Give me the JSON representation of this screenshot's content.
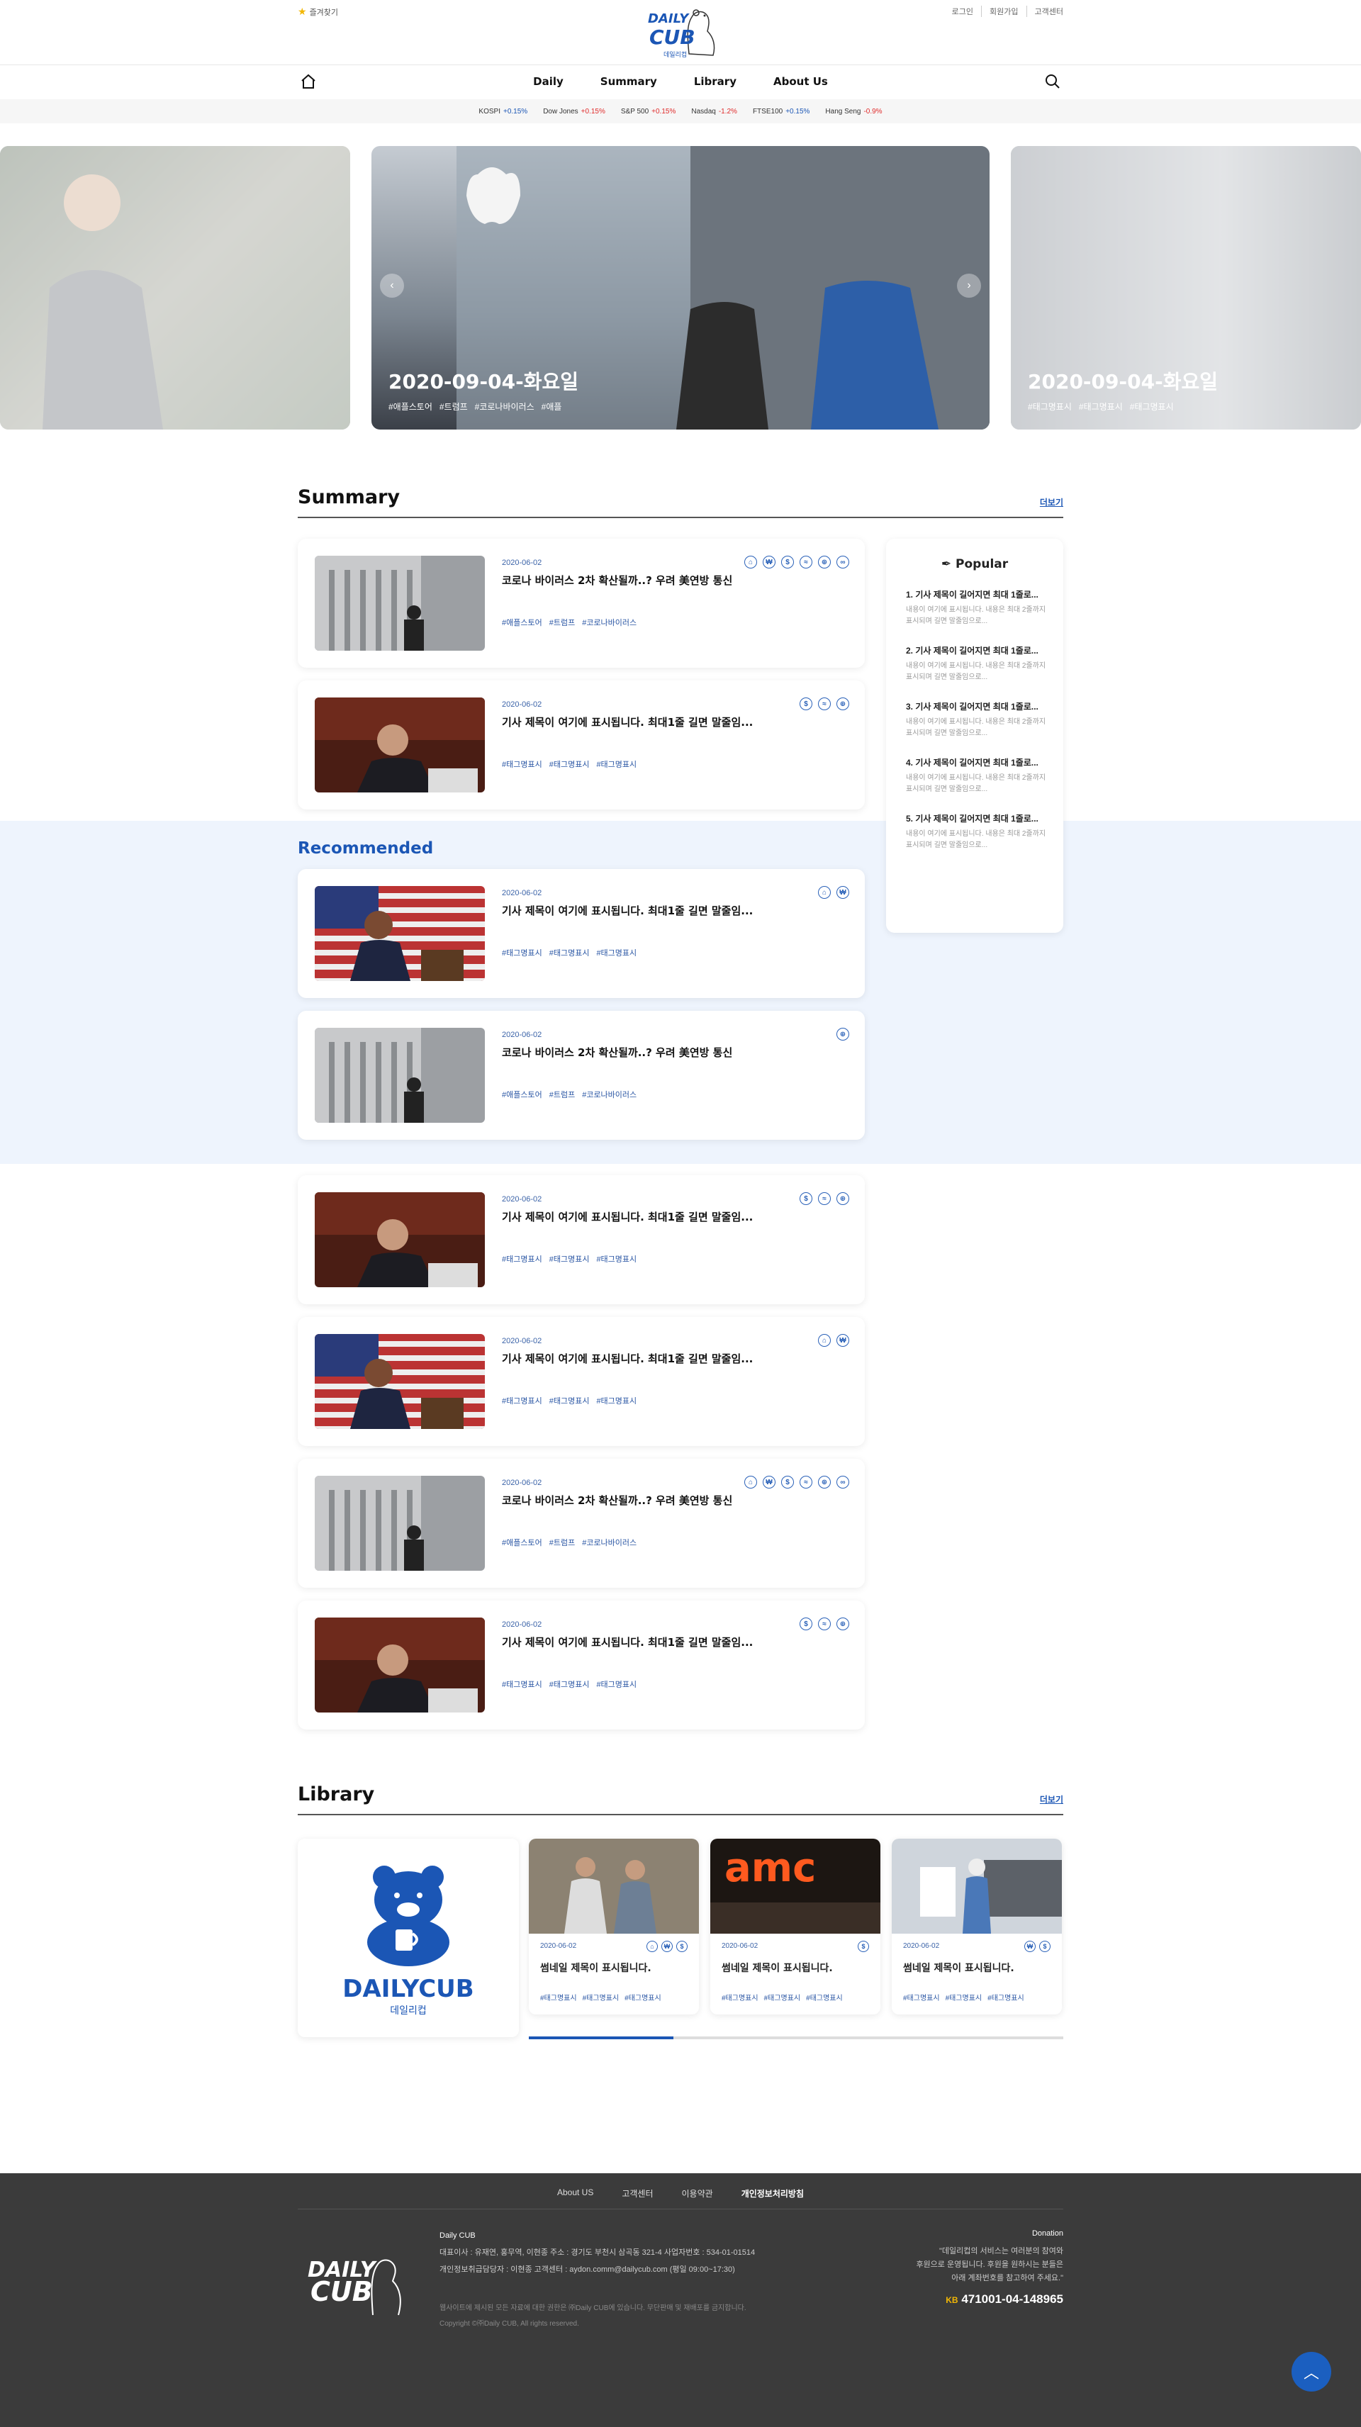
{
  "header": {
    "favorite": "즐겨찾기",
    "links": [
      "로그인",
      "회원가입",
      "고객센터"
    ],
    "logo_text_1": "DAILY",
    "logo_text_2": "CUB",
    "logo_sub": "데일리컵"
  },
  "nav": {
    "items": [
      "Daily",
      "Summary",
      "Library",
      "About Us"
    ]
  },
  "ticker": [
    {
      "name": "KOSPI",
      "change": "+0.15%",
      "dir": "up"
    },
    {
      "name": "Dow Jones",
      "change": "+0.15%",
      "dir": "down"
    },
    {
      "name": "S&P 500",
      "change": "+0.15%",
      "dir": "down"
    },
    {
      "name": "Nasdaq",
      "change": "-1.2%",
      "dir": "down"
    },
    {
      "name": "FTSE100",
      "change": "+0.15%",
      "dir": "up"
    },
    {
      "name": "Hang Seng",
      "change": "-0.9%",
      "dir": "down"
    }
  ],
  "carousel": {
    "main": {
      "date": "2020-09-04-화요일",
      "tags": [
        "#애플스토어",
        "#트럼프",
        "#코로나바이러스",
        "#애플"
      ]
    },
    "right": {
      "date": "2020-09-04-화요일",
      "tags": [
        "#태그명표시",
        "#태그명표시",
        "#태그명표시"
      ]
    }
  },
  "summary": {
    "heading": "Summary",
    "more": "더보기",
    "cards": [
      {
        "date": "2020-06-02",
        "title": "코로나 바이러스 2차 확산될까..? 우려 美연방 통신",
        "tags": [
          "#애플스토어",
          "#트럼프",
          "#코로나바이러스"
        ],
        "icons": [
          "bank",
          "won",
          "dollar",
          "wave",
          "globe",
          "people"
        ]
      },
      {
        "date": "2020-06-02",
        "title": "기사 제목이 여기에 표시됩니다. 최대1줄 길면 말줄임...",
        "tags": [
          "#태그명표시",
          "#태그명표시",
          "#태그명표시"
        ],
        "icons": [
          "dollar",
          "wave",
          "globe"
        ]
      }
    ]
  },
  "recommended": {
    "heading": "Recommended",
    "cards": [
      {
        "date": "2020-06-02",
        "title": "기사 제목이 여기에 표시됩니다. 최대1줄 길면 말줄임...",
        "tags": [
          "#태그명표시",
          "#태그명표시",
          "#태그명표시"
        ],
        "icons": [
          "bank",
          "won"
        ]
      },
      {
        "date": "2020-06-02",
        "title": "코로나 바이러스 2차 확산될까..? 우려 美연방 통신",
        "tags": [
          "#애플스토어",
          "#트럼프",
          "#코로나바이러스"
        ],
        "icons": [
          "globe"
        ]
      }
    ]
  },
  "more_cards": [
    {
      "date": "2020-06-02",
      "title": "기사 제목이 여기에 표시됩니다. 최대1줄 길면 말줄임...",
      "tags": [
        "#태그명표시",
        "#태그명표시",
        "#태그명표시"
      ],
      "icons": [
        "dollar",
        "wave",
        "globe"
      ]
    },
    {
      "date": "2020-06-02",
      "title": "기사 제목이 여기에 표시됩니다. 최대1줄 길면 말줄임...",
      "tags": [
        "#태그명표시",
        "#태그명표시",
        "#태그명표시"
      ],
      "icons": [
        "bank",
        "won"
      ]
    },
    {
      "date": "2020-06-02",
      "title": "코로나 바이러스 2차 확산될까..? 우려 美연방 통신",
      "tags": [
        "#애플스토어",
        "#트럼프",
        "#코로나바이러스"
      ],
      "icons": [
        "bank",
        "won",
        "dollar",
        "wave",
        "globe",
        "people"
      ]
    },
    {
      "date": "2020-06-02",
      "title": "기사 제목이 여기에 표시됩니다. 최대1줄 길면 말줄임...",
      "tags": [
        "#태그명표시",
        "#태그명표시",
        "#태그명표시"
      ],
      "icons": [
        "dollar",
        "wave",
        "globe"
      ]
    }
  ],
  "popular": {
    "heading": "Popular",
    "items": [
      {
        "title": "1. 기사 제목이 길어지면 최대 1줄로...",
        "desc": "내용이 여기에 표시됩니다. 내용은 최대 2줄까지 표시되며 길면 말줄임으로..."
      },
      {
        "title": "2. 기사 제목이 길어지면 최대 1줄로...",
        "desc": "내용이 여기에 표시됩니다. 내용은 최대 2줄까지 표시되며 길면 말줄임으로..."
      },
      {
        "title": "3. 기사 제목이 길어지면 최대 1줄로...",
        "desc": "내용이 여기에 표시됩니다. 내용은 최대 2줄까지 표시되며 길면 말줄임으로..."
      },
      {
        "title": "4. 기사 제목이 길어지면 최대 1줄로...",
        "desc": "내용이 여기에 표시됩니다. 내용은 최대 2줄까지 표시되며 길면 말줄임으로..."
      },
      {
        "title": "5. 기사 제목이 길어지면 최대 1줄로...",
        "desc": "내용이 여기에 표시됩니다. 내용은 최대 2줄까지 표시되며 길면 말줄임으로..."
      }
    ]
  },
  "library": {
    "heading": "Library",
    "more": "더보기",
    "brand": "DAILYCUB",
    "brand_sub": "데일리컵",
    "cards": [
      {
        "date": "2020-06-02",
        "title": "썸네일 제목이 표시됩니다.",
        "tags": [
          "#태그명표시",
          "#태그명표시",
          "#태그명표시"
        ],
        "icons": [
          "bank",
          "won",
          "dollar"
        ]
      },
      {
        "date": "2020-06-02",
        "title": "썸네일 제목이 표시됩니다.",
        "tags": [
          "#태그명표시",
          "#태그명표시",
          "#태그명표시"
        ],
        "icons": [
          "dollar"
        ]
      },
      {
        "date": "2020-06-02",
        "title": "썸네일 제목이 표시됩니다.",
        "tags": [
          "#태그명표시",
          "#태그명표시",
          "#태그명표시"
        ],
        "icons": [
          "won",
          "dollar"
        ]
      }
    ],
    "scroll_progress": 0.27
  },
  "footer": {
    "links": [
      "About US",
      "고객센터",
      "이용약관",
      "개인정보처리방침"
    ],
    "company": "Daily CUB",
    "line1": "대표이사 : 유재연, 홍무역, 이현종     주소 : 경기도 부천시 삼곡동 321-4     사업자번호 : 534-01-01514",
    "line2": "개인정보취급담당자 : 이현종     고객센터 : aydon.comm@dailycub.com (평일 09:00~17:30)",
    "copy1": "웹사이트에 제시된 모든 자료에 대한 권한은 ㈜Daily CUB에 있습니다. 무단판매 및 재배포를 금지합니다.",
    "copy2": "Copyright ©㈜Daily CUB, All rights reserved.",
    "donation_title": "Donation",
    "donation_text": [
      "\"데일리컵의 서비스는 여러분의 참여와",
      "후원으로 운영됩니다. 후원을 원하시는 분들은",
      "아래 계좌번호를 참고하여 주세요.\""
    ],
    "bank": "KB",
    "account": "471001-04-148965"
  },
  "colors": {
    "accent": "#1b56b5",
    "footer_bg": "#3b3b3b",
    "rec_bg": "#eef4fd"
  }
}
